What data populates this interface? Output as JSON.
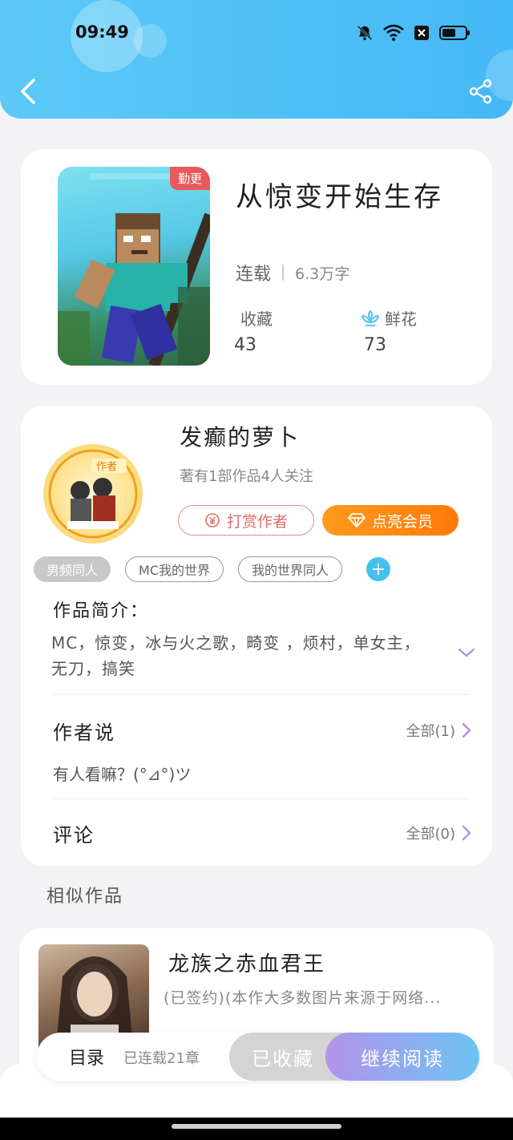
{
  "status_bar": {
    "time": "09:49"
  },
  "book": {
    "badge": "勤更",
    "title": "从惊变开始生存",
    "status": "连载",
    "word_count": "6.3万字",
    "favorites_label": "收藏",
    "favorites_count": "43",
    "flowers_label": "鲜花",
    "flowers_count": "73"
  },
  "author": {
    "name": "发癫的萝卜",
    "summary": "著有1部作品4人关注",
    "avatar_label": "作者",
    "tip_button": "打赏作者",
    "vip_button": "点亮会员"
  },
  "tags": [
    "男频同人",
    "MC我的世界",
    "我的世界同人"
  ],
  "intro": {
    "title": "作品简介：",
    "text": "MC，惊变，冰与火之歌，畸变 ，烦村，单女主，无刀，搞笑"
  },
  "author_says": {
    "title": "作者说",
    "link": "全部(1)",
    "content": "有人看嘛？(°⊿°)ツ"
  },
  "comments": {
    "title": "评论",
    "link": "全部(0)"
  },
  "similar": {
    "section_title": "相似作品",
    "items": [
      {
        "title": "龙族之赤血君王",
        "desc": "(已签约)(本作大多数图片来源于网络..."
      }
    ]
  },
  "bottom": {
    "toc": "目录",
    "chapters": "已连载21章",
    "favorited": "已收藏",
    "continue": "继续阅读"
  },
  "colors": {
    "header": "#4ec0f7",
    "vip": "#ff8a10",
    "tip": "#e06b6b",
    "accent": "#48c0ef"
  },
  "icons": [
    "back-icon",
    "share-icon",
    "bell-off-icon",
    "wifi-icon",
    "battery-icon",
    "flower-icon",
    "coin-icon",
    "diamond-icon",
    "chevron-down-icon",
    "chevron-right-icon",
    "plus-icon"
  ]
}
